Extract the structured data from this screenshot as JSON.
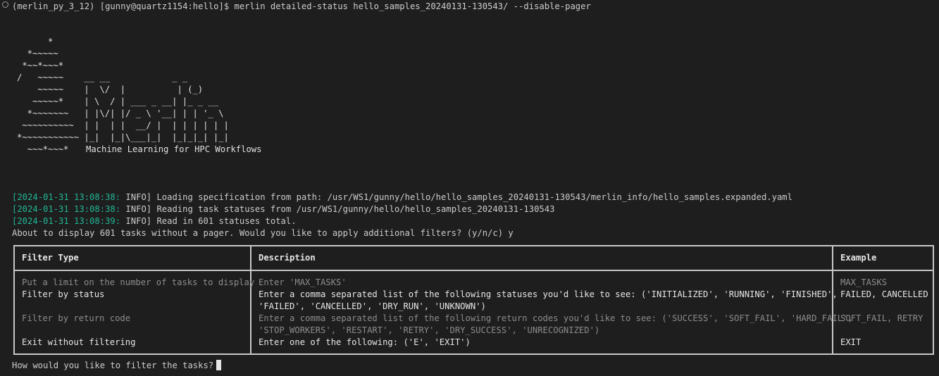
{
  "terminal": {
    "command_line": "(merlin_py_3_12) [gunny@quartz1154:hello]$ merlin detailed-status hello_samples_20240131-130543/ --disable-pager",
    "banner_art": "      *\n  *~~~~~\n *~~*~~~*\n/   ~~~~~    __ __            _ _\n    ~~~~~    |  \\/  |          | (_)\n   ~~~~~*    | \\  / | ___ _ __| |_ _ __\n  *~~~~~~~   | |\\/| |/ _ \\ '__| | | '_ \\\n ~~~~~~~~~~  | |  | |  __/ |  | | | | | |\n*~~~~~~~~~~~ |_|  |_|\\___|_|  |_|_|_| |_|\n  ~~~*~~~*",
    "tagline": "Machine Learning for HPC Workflows",
    "logs": [
      {
        "timestamp": "[2024-01-31 13:08:38:",
        "level": " INFO]",
        "message": " Loading specification from path: /usr/WS1/gunny/hello/hello_samples_20240131-130543/merlin_info/hello_samples.expanded.yaml"
      },
      {
        "timestamp": "[2024-01-31 13:08:38:",
        "level": " INFO]",
        "message": " Reading task statuses from /usr/WS1/gunny/hello/hello_samples_20240131-130543"
      },
      {
        "timestamp": "[2024-01-31 13:08:39:",
        "level": " INFO]",
        "message": " Read in 601 statuses total."
      }
    ],
    "filter_question": "About to display 601 tasks without a pager. Would you like to apply additional filters? (y/n/c) y",
    "input_prompt": "How would you like to filter the tasks?"
  },
  "filter_table": {
    "headers": [
      "Filter Type",
      "Description",
      "Example"
    ],
    "rows": [
      {
        "type": "Put a limit on the number of tasks to display",
        "description": "Enter 'MAX_TASKS'",
        "example": "MAX_TASKS",
        "style": "dim"
      },
      {
        "type": "Filter by status",
        "description": "Enter a comma separated list of the following statuses you'd like to see: ('INITIALIZED', 'RUNNING', 'FINISHED',\n'FAILED', 'CANCELLED', 'DRY_RUN', 'UNKNOWN')",
        "example": "FAILED, CANCELLED",
        "style": "bright"
      },
      {
        "type": "Filter by return code",
        "description": "Enter a comma separated list of the following return codes you'd like to see: ('SUCCESS', 'SOFT_FAIL', 'HARD_FAIL',\n'STOP_WORKERS', 'RESTART', 'RETRY', 'DRY_SUCCESS', 'UNRECOGNIZED')",
        "example": "SOFT_FAIL, RETRY",
        "style": "dim"
      },
      {
        "type": "Exit without filtering",
        "description": "Enter one of the following: ('E', 'EXIT')",
        "example": "EXIT",
        "style": "bright"
      }
    ]
  },
  "colors": {
    "background": "#1e1e1e",
    "text": "#cccccc",
    "timestamp_green": "#21b796",
    "dim_row": "#8c8c8c"
  }
}
